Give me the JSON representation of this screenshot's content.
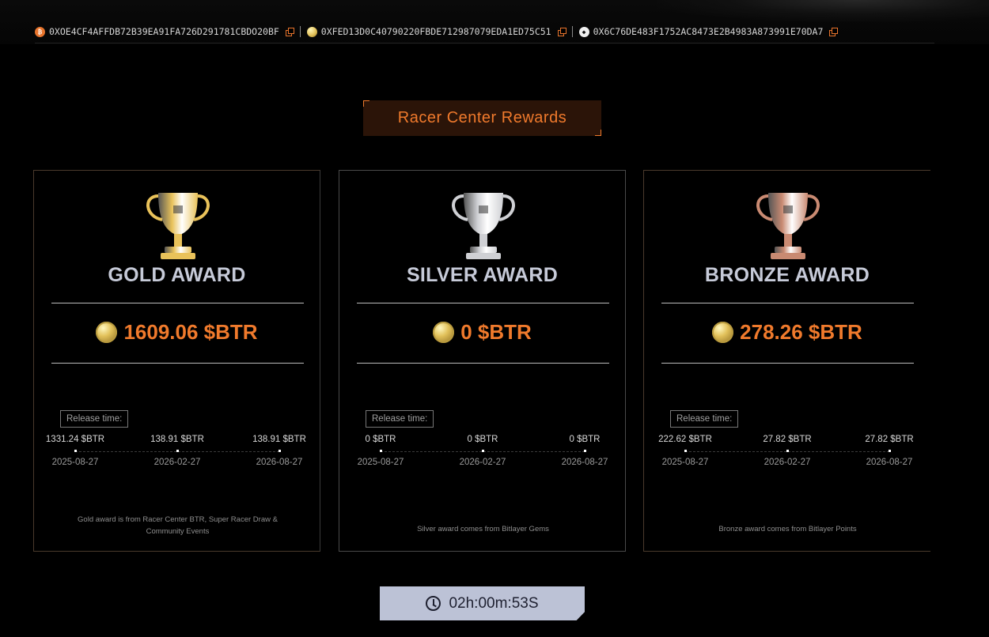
{
  "addresses": [
    {
      "chain_icon": "bitcoin-icon",
      "color": "#e8742c",
      "glyph": "₿",
      "address": "0XOE4CF4AFFDB72B39EA91FA726D291781CBDO20BF"
    },
    {
      "chain_icon": "coin-icon",
      "color": "#e2c15a",
      "glyph": "",
      "address": "0XFED13D0C40790220FBDE712987079EDA1ED75C51"
    },
    {
      "chain_icon": "ethereum-icon",
      "color": "#e8e8e8",
      "glyph": "◆",
      "address": "0X6C76DE483F1752AC8473E2B4983A873991E70DA7"
    }
  ],
  "section_title": "Racer Center Rewards",
  "release_label": "Release time:",
  "cards": [
    {
      "title": "GOLD AWARD",
      "amount": "1609.06 $BTR",
      "trophy_color": "#e9c25a",
      "timeline": [
        {
          "amount": "1331.24 $BTR",
          "date": "2025-08-27"
        },
        {
          "amount": "138.91 $BTR",
          "date": "2026-02-27"
        },
        {
          "amount": "138.91 $BTR",
          "date": "2026-08-27"
        }
      ],
      "footnote": "Gold award is from Racer Center BTR, Super Racer Draw & Community Events"
    },
    {
      "title": "SILVER AWARD",
      "amount": "0 $BTR",
      "trophy_color": "#cfd0d4",
      "timeline": [
        {
          "amount": "0 $BTR",
          "date": "2025-08-27"
        },
        {
          "amount": "0 $BTR",
          "date": "2026-02-27"
        },
        {
          "amount": "0 $BTR",
          "date": "2026-08-27"
        }
      ],
      "footnote": "Silver award comes from Bitlayer Gems"
    },
    {
      "title": "BRONZE AWARD",
      "amount": "278.26 $BTR",
      "trophy_color": "#c98a72",
      "timeline": [
        {
          "amount": "222.62 $BTR",
          "date": "2025-08-27"
        },
        {
          "amount": "27.82 $BTR",
          "date": "2026-02-27"
        },
        {
          "amount": "27.82 $BTR",
          "date": "2026-08-27"
        }
      ],
      "footnote": "Bronze award comes from Bitlayer Points"
    }
  ],
  "countdown": "02h:00m:53S",
  "colors": {
    "accent": "#f07a2c",
    "title_text": "#c6cad8",
    "countdown_bg": "#bcc2d6"
  }
}
